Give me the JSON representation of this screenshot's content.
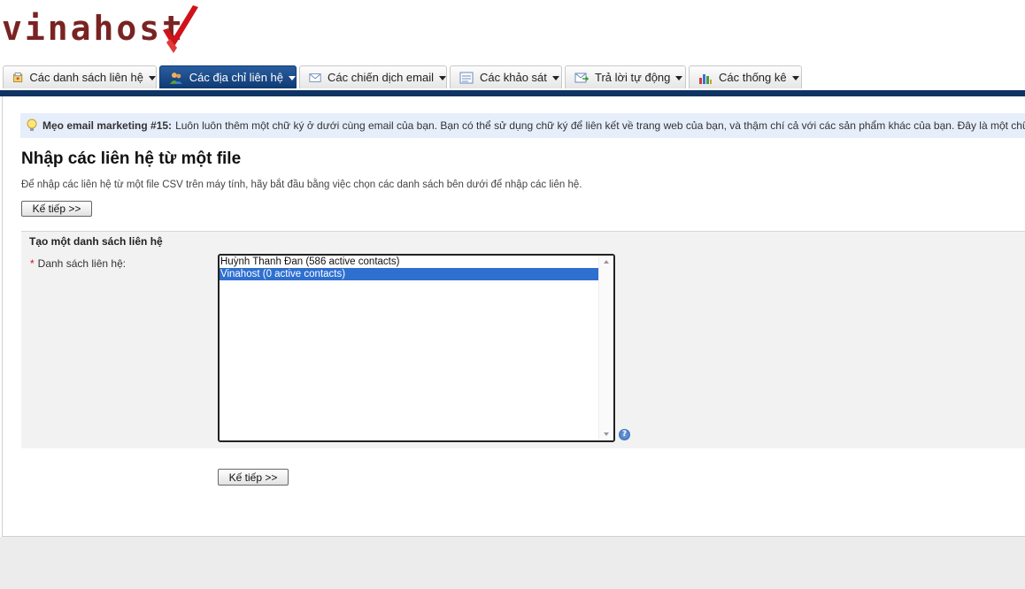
{
  "logo": {
    "text": "vinahost"
  },
  "tabs": [
    {
      "label": "Các danh sách liên hệ",
      "icon": "contact-list-icon",
      "active": false
    },
    {
      "label": "Các địa chỉ liên hệ",
      "icon": "contacts-icon",
      "active": true
    },
    {
      "label": "Các chiến dịch email",
      "icon": "envelope-icon",
      "active": false
    },
    {
      "label": "Các khảo sát",
      "icon": "survey-icon",
      "active": false
    },
    {
      "label": "Trả lời tự động",
      "icon": "autoresponder-icon",
      "active": false
    },
    {
      "label": "Các thống kê",
      "icon": "bar-chart-icon",
      "active": false
    }
  ],
  "tip": {
    "title": "Mẹo email marketing #15:",
    "text": "Luôn luôn thêm một chữ ký ở dưới cùng email của bạn. Bạn có thể sử dụng chữ ký để liên kết về trang web của bạn, và thậm chí cả với các sản phẩm khác của bạn. Đây là một chữ kí mẫu: Thân mến"
  },
  "page": {
    "title": "Nhập các liên hệ từ một file",
    "description": "Để nhập các liên hệ từ một file CSV trên máy tính, hãy bắt đầu bằng việc chọn các danh sách bên dưới để nhập các liên hệ.",
    "next_top": "Kế tiếp >>",
    "next_bottom": "Kế tiếp >>"
  },
  "section": {
    "title": "Tạo một danh sách liên hệ",
    "required_mark": "*",
    "field_label": "Danh sách liên hệ:",
    "options": [
      {
        "label": "Huỳnh Thanh Đan (586 active contacts)",
        "selected": false
      },
      {
        "label": "Vinahost (0 active contacts)",
        "selected": true
      }
    ],
    "help": "?"
  },
  "colors": {
    "nav_bar": "#0f3463",
    "active_tab": "#1f4e8c",
    "tip_bg": "#e6eefb",
    "selection": "#2f6fcf",
    "logo_accent": "#d0121b"
  }
}
